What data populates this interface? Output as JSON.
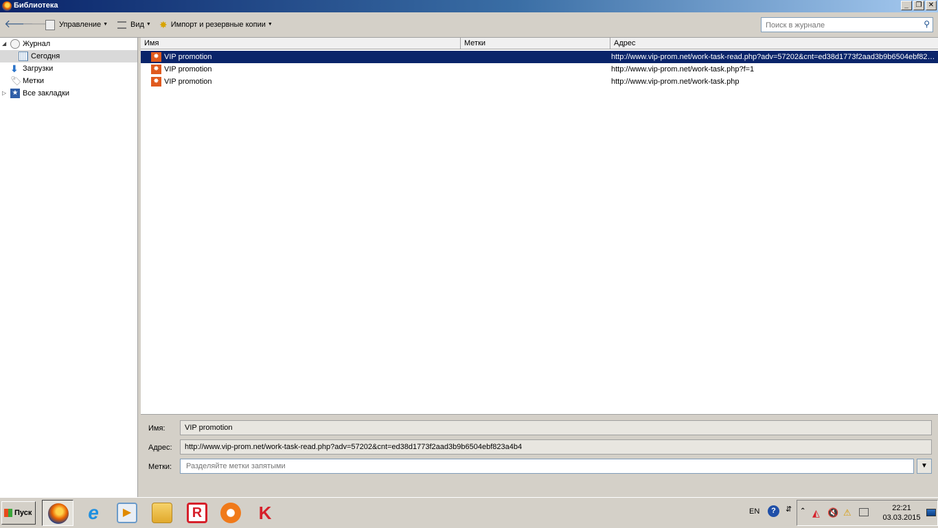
{
  "window": {
    "title": "Библиотека"
  },
  "toolbar": {
    "manage": "Управление",
    "view": "Вид",
    "import": "Импорт и резервные копии",
    "search_placeholder": "Поиск в журнале"
  },
  "sidebar": {
    "items": [
      {
        "label": "Журнал",
        "icon": "clock-icon"
      },
      {
        "label": "Сегодня",
        "icon": "calendar-icon"
      },
      {
        "label": "Загрузки",
        "icon": "download-icon"
      },
      {
        "label": "Метки",
        "icon": "tag-icon"
      },
      {
        "label": "Все закладки",
        "icon": "bookmarks-icon"
      }
    ]
  },
  "list": {
    "columns": [
      "Имя",
      "Метки",
      "Адрес"
    ],
    "rows": [
      {
        "name": "VIP promotion",
        "tags": "",
        "url": "http://www.vip-prom.net/work-task-read.php?adv=57202&cnt=ed38d1773f2aad3b9b6504ebf823a4b4"
      },
      {
        "name": "VIP promotion",
        "tags": "",
        "url": "http://www.vip-prom.net/work-task.php?f=1"
      },
      {
        "name": "VIP promotion",
        "tags": "",
        "url": "http://www.vip-prom.net/work-task.php"
      }
    ]
  },
  "details": {
    "name_label": "Имя:",
    "name_value": "VIP promotion",
    "address_label": "Адрес:",
    "address_value": "http://www.vip-prom.net/work-task-read.php?adv=57202&cnt=ed38d1773f2aad3b9b6504ebf823a4b4",
    "tags_label": "Метки:",
    "tags_placeholder": "Разделяйте метки запятыми"
  },
  "taskbar": {
    "start": "Пуск",
    "lang": "EN",
    "time": "22:21",
    "date": "03.03.2015"
  }
}
